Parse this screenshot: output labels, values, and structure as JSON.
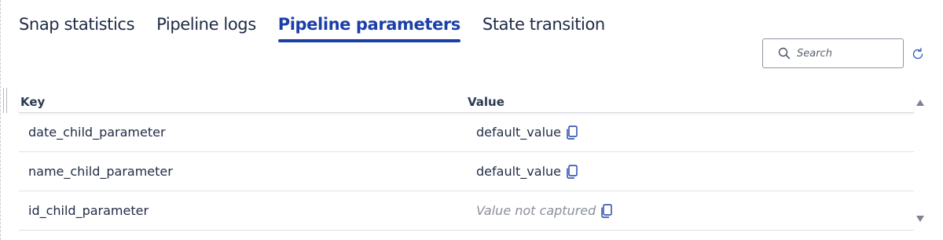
{
  "tabs": [
    {
      "label": "Snap statistics",
      "active": false
    },
    {
      "label": "Pipeline logs",
      "active": false
    },
    {
      "label": "Pipeline parameters",
      "active": true
    },
    {
      "label": "State transition",
      "active": false
    }
  ],
  "search": {
    "placeholder": "Search",
    "value": "",
    "icon": "search-icon"
  },
  "refresh": {
    "icon": "refresh-icon"
  },
  "table": {
    "columns": {
      "key": "Key",
      "value": "Value"
    },
    "rows": [
      {
        "key": "date_child_parameter",
        "value": "default_value",
        "captured": true
      },
      {
        "key": "name_child_parameter",
        "value": "default_value",
        "captured": true
      },
      {
        "key": "id_child_parameter",
        "value": "Value not captured",
        "captured": false
      }
    ]
  },
  "colors": {
    "accent": "#1b3fa8",
    "text": "#1f2a44",
    "muted": "#8a8f9a",
    "border": "#dfe2e7"
  }
}
